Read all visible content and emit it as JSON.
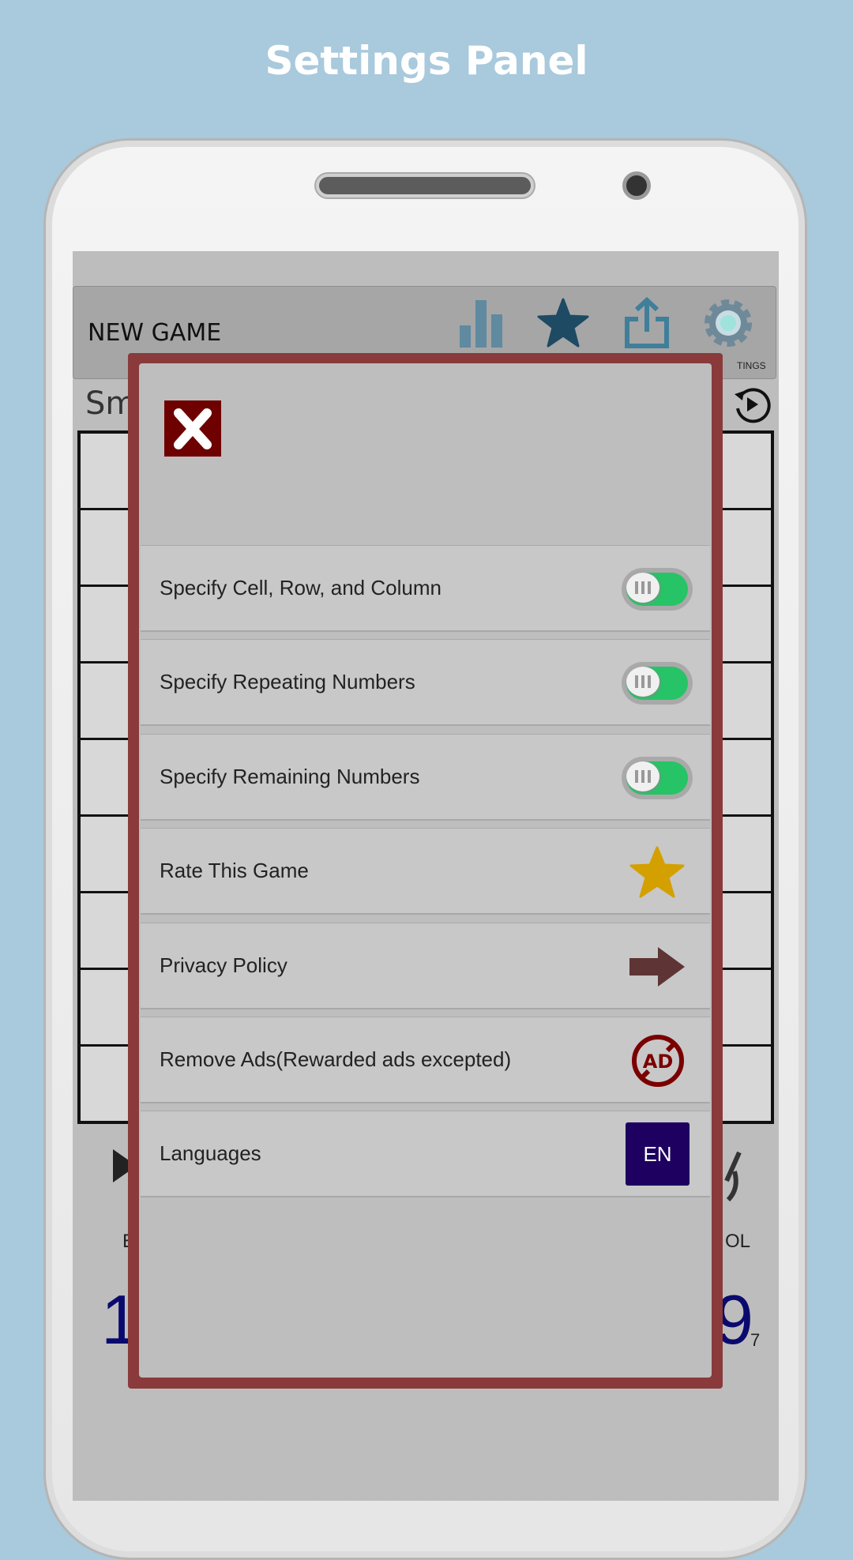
{
  "caption": "Settings Panel",
  "header": {
    "new_game": "NEW GAME",
    "icons": [
      "bar-chart-icon",
      "star-icon",
      "share-icon",
      "gear-icon"
    ],
    "settings_partial": "TINGS"
  },
  "background": {
    "mode_partial": "Sm",
    "left_label_partial": "E",
    "right_label_partial": "OL",
    "left_number_partial": "1",
    "right_number_partial": "9",
    "right_count": "7"
  },
  "settings": {
    "close_icon": "close-x-icon",
    "rows": [
      {
        "label": "Specify Cell, Row, and Column",
        "control": "toggle",
        "on": true
      },
      {
        "label": "Specify Repeating Numbers",
        "control": "toggle",
        "on": true
      },
      {
        "label": "Specify Remaining Numbers",
        "control": "toggle",
        "on": true
      },
      {
        "label": "Rate This Game",
        "control": "star-icon"
      },
      {
        "label": "Privacy Policy",
        "control": "arrow-right-icon"
      },
      {
        "label": "Remove Ads(Rewarded ads excepted)",
        "control": "no-ads-icon"
      },
      {
        "label": "Languages",
        "control": "language-button",
        "value": "EN"
      }
    ]
  },
  "colors": {
    "modal_border": "#8a3a3a",
    "close": "#6e0000",
    "toggle_on": "#26c466",
    "star": "#d4a000",
    "arrow": "#5e3434",
    "no_ads": "#7a0000",
    "language": "#1e0060",
    "numbers": "#0a0a6e"
  }
}
